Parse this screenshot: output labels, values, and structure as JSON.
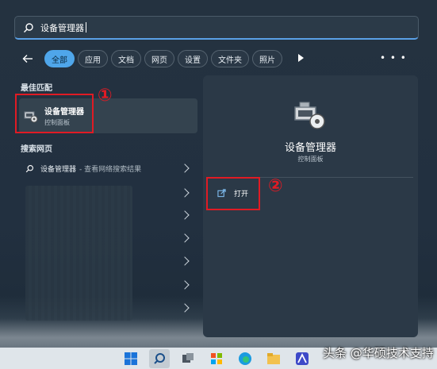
{
  "search": {
    "value": "设备管理器"
  },
  "filters": [
    "全部",
    "应用",
    "文档",
    "网页",
    "设置",
    "文件夹",
    "照片"
  ],
  "left": {
    "best_match_title": "最佳匹配",
    "best_match": {
      "name": "设备管理器",
      "sub": "控制面板"
    },
    "web_title": "搜索网页",
    "web_result": {
      "name": "设备管理器",
      "suffix": " - 查看网络搜索结果"
    }
  },
  "right": {
    "title": "设备管理器",
    "sub": "控制面板",
    "open_label": "打开"
  },
  "annotations": {
    "one": "①",
    "two": "②"
  },
  "watermark": "头条 @华硕技术支持",
  "colors": {
    "accent": "#4fa6ea",
    "annotation": "#e01b24"
  }
}
